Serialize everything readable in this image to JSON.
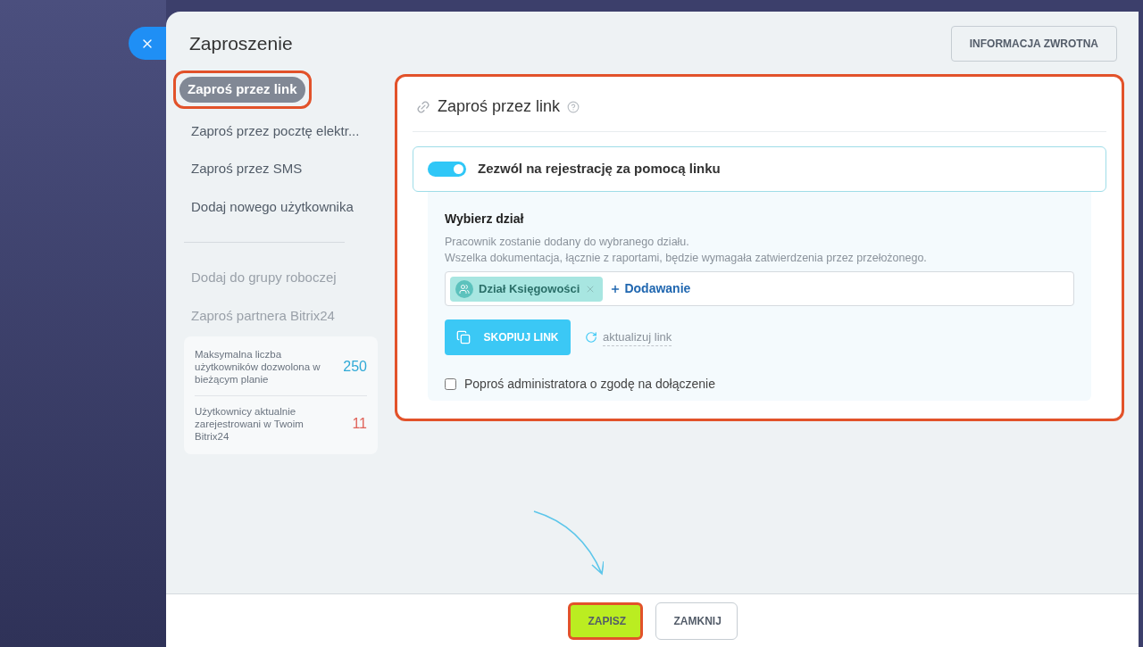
{
  "dialog": {
    "title": "Zaproszenie",
    "feedback_button": "INFORMACJA ZWROTNA"
  },
  "nav": {
    "items": [
      {
        "label": "Zaproś przez link",
        "selected": true,
        "highlighted": true,
        "disabled": false
      },
      {
        "label": "Zaproś przez pocztę elektr...",
        "selected": false,
        "highlighted": false,
        "disabled": false
      },
      {
        "label": "Zaproś przez SMS",
        "selected": false,
        "highlighted": false,
        "disabled": false
      },
      {
        "label": "Dodaj nowego użytkownika",
        "selected": false,
        "highlighted": false,
        "disabled": false
      }
    ],
    "more_items": [
      {
        "label": "Dodaj do grupy roboczej",
        "disabled": true
      },
      {
        "label": "Zaproś partnera Bitrix24",
        "disabled": true
      }
    ]
  },
  "stats": [
    {
      "label": "Maksymalna liczba użytkowników dozwolona w bieżącym planie",
      "value": "250",
      "color": "#2fa9d6"
    },
    {
      "label": "Użytkownicy aktualnie zarejestrowani w Twoim Bitrix24",
      "value": "11",
      "color": "#e0635a"
    }
  ],
  "content": {
    "highlighted": true,
    "title": "Zaproś przez link",
    "toggle": {
      "label": "Zezwól na rejestrację za pomocą linku",
      "on": true
    },
    "department": {
      "title": "Wybierz dział",
      "hint_lines": [
        "Pracownik zostanie dodany do wybranego działu.",
        "Wszelka dokumentacja, łącznie z raportami, będzie wymagała zatwierdzenia przez przełożonego."
      ],
      "tags": [
        {
          "label": "Dział Księgowości"
        }
      ],
      "add_label": "Dodawanie"
    },
    "copy_button": "SKOPIUJ LINK",
    "refresh_link": "aktualizuj link",
    "approval": {
      "label": "Poproś administratora o zgodę na dołączenie",
      "checked": false
    }
  },
  "footer": {
    "buttons": [
      {
        "label": "ZAPISZ",
        "kind": "primary",
        "highlighted": true
      },
      {
        "label": "ZAMKNIJ",
        "kind": "secondary",
        "highlighted": false
      }
    ]
  }
}
